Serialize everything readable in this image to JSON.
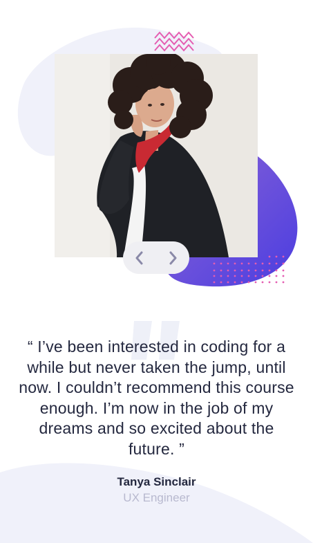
{
  "testimonial": {
    "quote": "“ I’ve been interested in coding for a while but never taken the jump, until now. I couldn’t recommend this course enough. I’m now in the job of my dreams and so excited about the future. ”",
    "name": "Tanya Sinclair",
    "role": "UX Engineer"
  },
  "icons": {
    "prev": "chevron-left-icon",
    "next": "chevron-right-icon",
    "pattern_top": "zigzag-pattern",
    "pattern_bottom": "dots-pattern",
    "quote": "quote-icon"
  },
  "colors": {
    "text_dark": "#24283f",
    "text_muted": "#b8b9cf",
    "accent_purple_start": "#8a64d6",
    "accent_purple_end": "#4b3de0",
    "pink": "#e45db1",
    "bg_curve": "#f0f1fa"
  }
}
